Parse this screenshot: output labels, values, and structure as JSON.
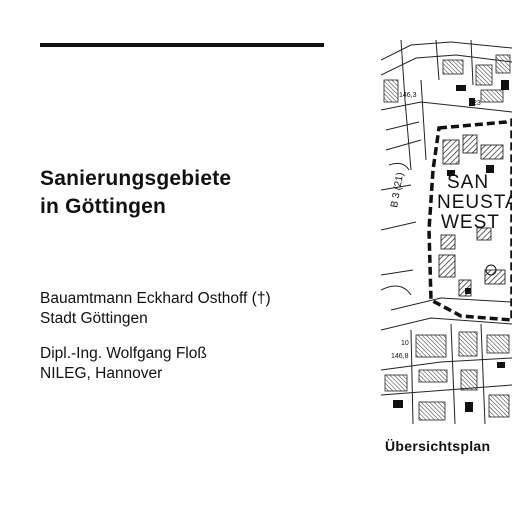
{
  "document": {
    "title_lines": [
      "Sanierungsgebiete",
      "in Göttingen"
    ],
    "authors": [
      {
        "lines": [
          "Bauamtmann Eckhard Osthoff (†)",
          "Stadt Göttingen"
        ]
      },
      {
        "lines": [
          "Dipl.-Ing. Wolfgang Floß",
          "NILEG, Hannover"
        ]
      }
    ]
  },
  "map": {
    "area_label_lines": [
      "SAN",
      "NEUSTA",
      "WEST"
    ],
    "labels": {
      "road": "B 3 (21)",
      "parcel_top": "146,3",
      "parcel_bottom": "146,8",
      "number_23": "23",
      "number_10": "10"
    },
    "caption": "Übersichtsplan"
  }
}
